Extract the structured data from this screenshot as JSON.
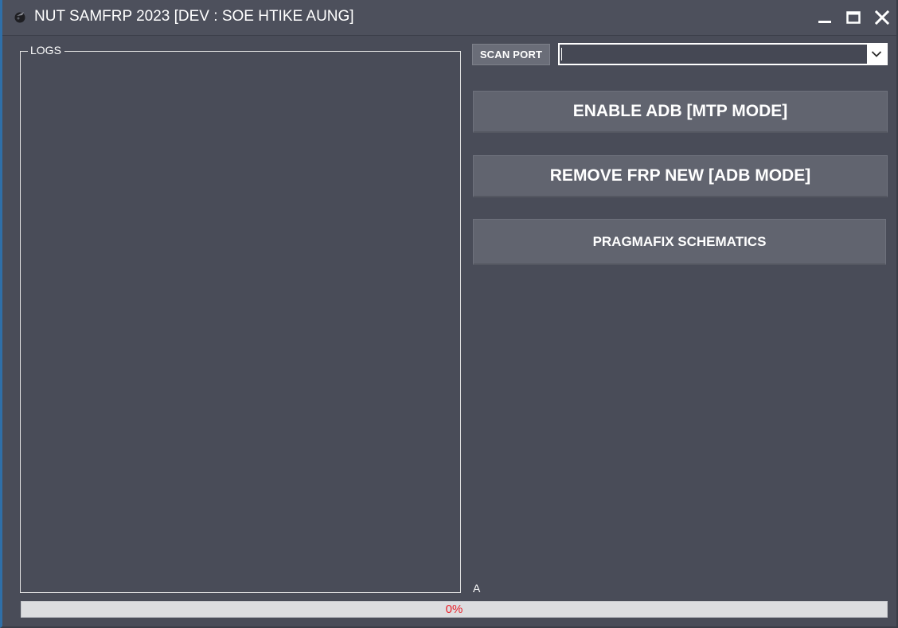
{
  "window": {
    "title": "NUT SAMFRP 2023 [DEV : SOE HTIKE AUNG]",
    "icons": {
      "app": "app-logo-icon",
      "minimize": "minimize-icon",
      "maximize": "maximize-icon",
      "close": "close-icon"
    }
  },
  "logs": {
    "label": "LOGS",
    "content": ""
  },
  "port": {
    "scan_label": "SCAN PORT",
    "selected": "",
    "dropdown_icon": "chevron-down-icon"
  },
  "actions": {
    "enable_adb": "ENABLE ADB [MTP MODE]",
    "remove_frp": "REMOVE FRP NEW [ADB MODE]",
    "pragmafix": "PRAGMAFIX SCHEMATICS"
  },
  "status": {
    "label": "A"
  },
  "progress": {
    "value": 0,
    "text": "0%"
  },
  "colors": {
    "background": "#494c58",
    "button": "#61646f",
    "progress_text": "#e8212b",
    "window_border": "#2f6fa8"
  }
}
